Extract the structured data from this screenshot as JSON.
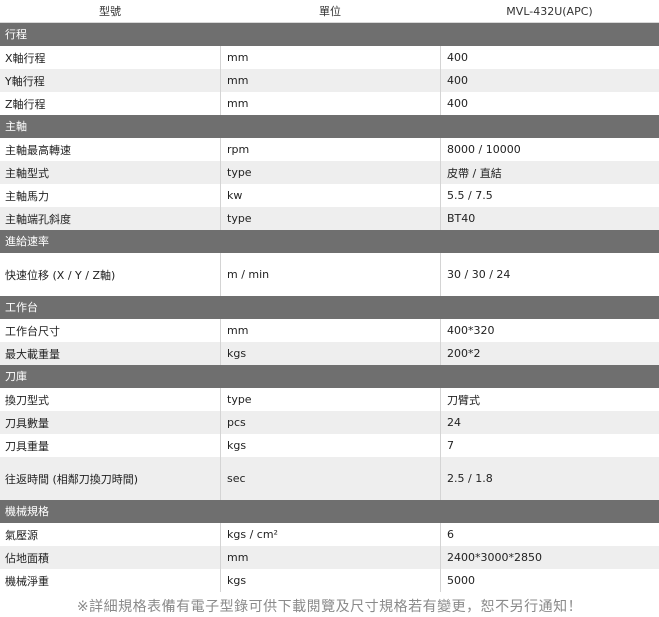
{
  "header": {
    "model_label": "型號",
    "unit_label": "單位",
    "model_value": "MVL-432U(APC)"
  },
  "sections": [
    {
      "title": "行程",
      "rows": [
        {
          "name": "X軸行程",
          "unit": "mm",
          "value": "400"
        },
        {
          "name": "Y軸行程",
          "unit": "mm",
          "value": "400"
        },
        {
          "name": "Z軸行程",
          "unit": "mm",
          "value": "400"
        }
      ]
    },
    {
      "title": "主軸",
      "rows": [
        {
          "name": "主軸最高轉速",
          "unit": "rpm",
          "value": "8000 / 10000"
        },
        {
          "name": "主軸型式",
          "unit": "type",
          "value": "皮帶 / 直結"
        },
        {
          "name": "主軸馬力",
          "unit": "kw",
          "value": "5.5 / 7.5"
        },
        {
          "name": "主軸端孔斜度",
          "unit": "type",
          "value": "BT40"
        }
      ]
    },
    {
      "title": "進給速率",
      "rows": [
        {
          "name": "快速位移 (X / Y / Z軸)",
          "unit": "m / min",
          "value": "30 / 30 / 24",
          "tall": true
        }
      ]
    },
    {
      "title": "工作台",
      "rows": [
        {
          "name": "工作台尺寸",
          "unit": "mm",
          "value": "400*320"
        },
        {
          "name": "最大載重量",
          "unit": "kgs",
          "value": "200*2"
        }
      ]
    },
    {
      "title": "刀庫",
      "rows": [
        {
          "name": "換刀型式",
          "unit": "type",
          "value": "刀臂式"
        },
        {
          "name": "刀具數量",
          "unit": "pcs",
          "value": "24"
        },
        {
          "name": "刀具重量",
          "unit": "kgs",
          "value": "7"
        },
        {
          "name": "往返時間 (相鄰刀換刀時間)",
          "unit": "sec",
          "value": "2.5 / 1.8",
          "tall": true
        }
      ]
    },
    {
      "title": "機械規格",
      "rows": [
        {
          "name": "氣壓源",
          "unit": "kgs / cm²",
          "value": "6"
        },
        {
          "name": "佔地面積",
          "unit": "mm",
          "value": "2400*3000*2850"
        },
        {
          "name": "機械淨重",
          "unit": "kgs",
          "value": "5000"
        }
      ]
    }
  ],
  "footer_note": "※詳細規格表備有電子型錄可供下載閱覽及尺寸規格若有變更，恕不另行通知！"
}
